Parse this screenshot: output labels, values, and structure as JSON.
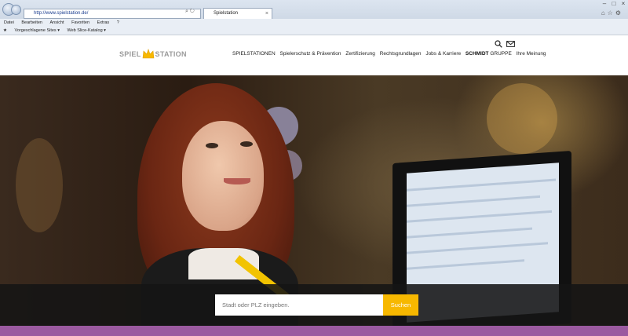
{
  "browser": {
    "address": "http://www.spielstation.de/",
    "tab_title": "Spielstation",
    "tab_close": "×",
    "menu": [
      "Datei",
      "Bearbeiten",
      "Ansicht",
      "Favoriten",
      "Extras",
      "?"
    ],
    "favorites": [
      "Vorgeschlagene Sites ▾",
      "Web Slice-Katalog ▾"
    ],
    "icons": [
      "back-icon",
      "forward-icon",
      "search-icon",
      "refresh-icon",
      "home-icon",
      "star-icon",
      "gear-icon"
    ]
  },
  "site": {
    "logo_left": "SPIEL",
    "logo_right": "STATION",
    "nav": [
      "SPIELSTATIONEN",
      "Spielerschutz & Prävention",
      "Zertifizierung",
      "Rechtsgrundlagen",
      "Jobs & Karriere"
    ],
    "nav_strong": "SCHMIDT",
    "nav_light": "GRUPPE",
    "nav_last": "Ihre Meinung",
    "brand_color": "#9a9a9a",
    "accent_color": "#f7b800"
  },
  "search": {
    "placeholder": "Stadt oder PLZ eingeben.",
    "button_label": "Suchen"
  },
  "footer_bar_color": "#9b5aa0"
}
